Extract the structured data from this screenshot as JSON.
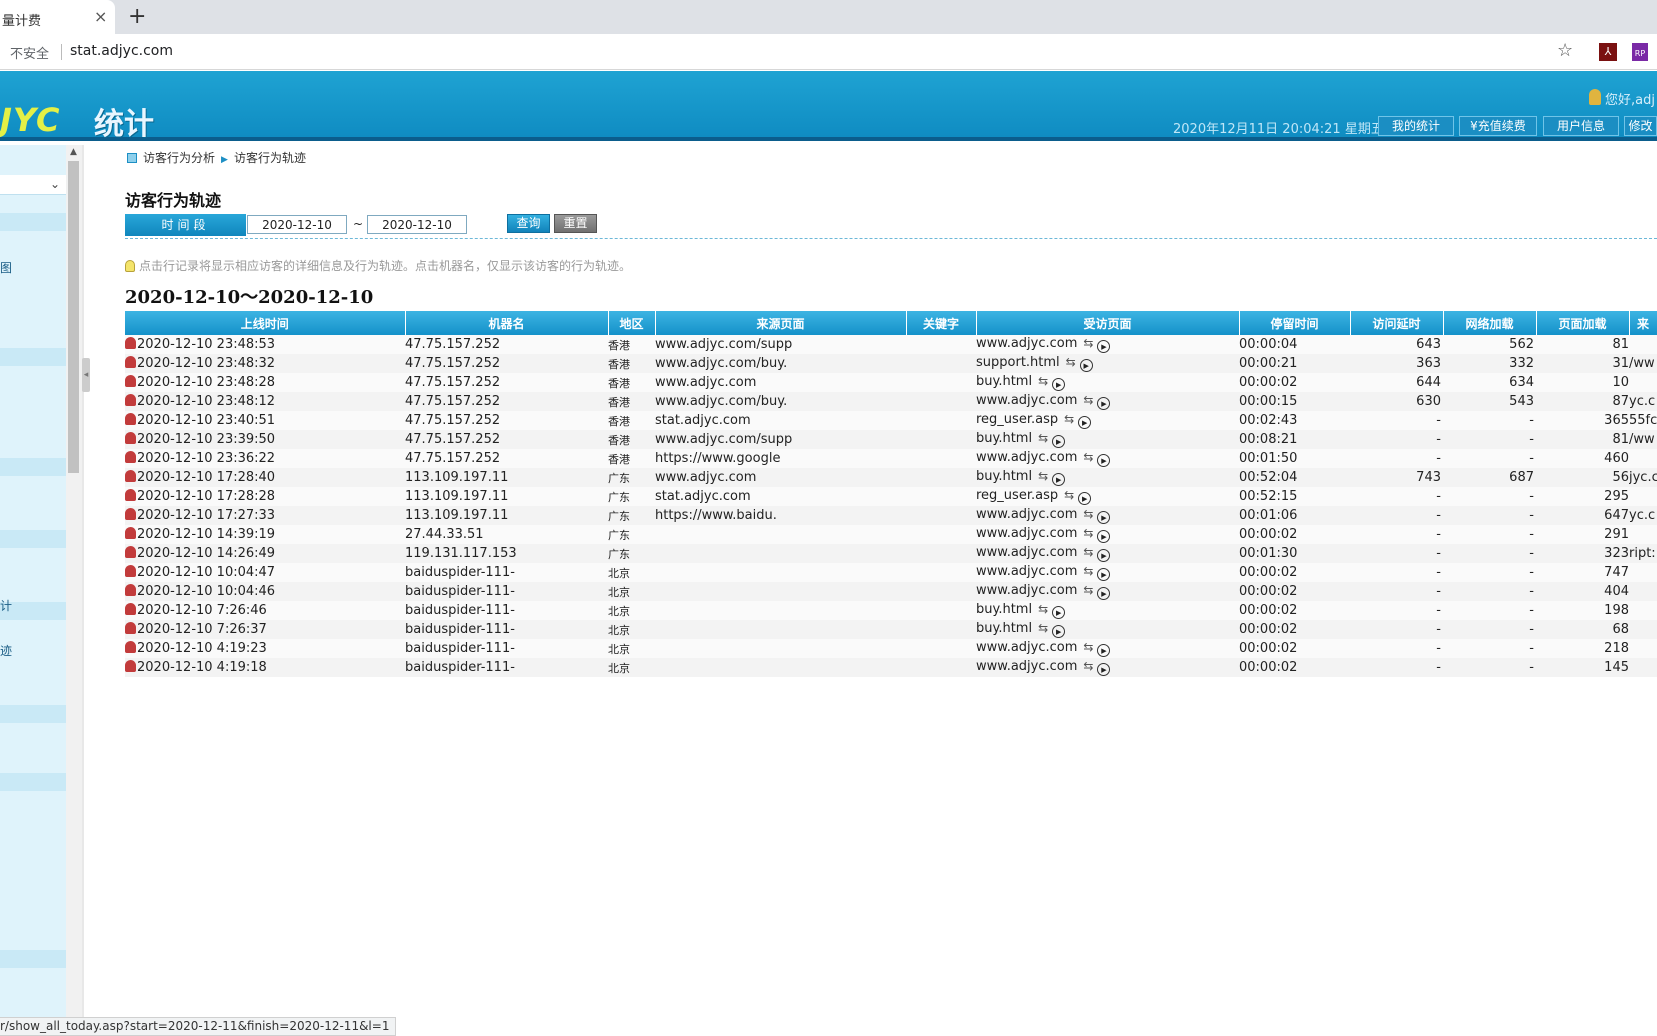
{
  "browser": {
    "tab_title": "量计费",
    "tab_close": "×",
    "new_tab": "+",
    "security_label": "不安全",
    "url": "stat.adjyc.com",
    "star": "☆",
    "status_url": "r/show_all_today.asp?start=2020-12-11&finish=2020-12-11&l=1"
  },
  "header": {
    "logo": "JYC",
    "logo_cn": "统计",
    "greeting": "您好,adj",
    "datetime": "2020年12月11日 20:04:21 星期五",
    "nav": [
      "我的统计",
      "¥充值续费",
      "用户信息",
      "修改"
    ]
  },
  "sidebar": {
    "fragments": [
      "图",
      "计",
      "迹"
    ]
  },
  "breadcrumb": {
    "parent": "访客行为分析",
    "current": "访客行为轨迹"
  },
  "page": {
    "title": "访客行为轨迹",
    "period_label": "时间段",
    "start_date": "2020-12-10",
    "tilde": "~",
    "end_date": "2020-12-10",
    "query_button": "查询",
    "reset_button": "重置",
    "hint": "点击行记录将显示相应访客的详细信息及行为轨迹。点击机器名，仅显示该访客的行为轨迹。",
    "range_title": "2020-12-10～2020-12-10"
  },
  "table": {
    "columns": [
      "上线时间",
      "机器名",
      "地区",
      "来源页面",
      "关键字",
      "受访页面",
      "停留时间",
      "访问延时",
      "网络加载",
      "页面加载",
      "来"
    ],
    "rows": [
      {
        "time": "2020-12-10 23:48:53",
        "host": "47.75.157.252",
        "region": "香港",
        "source": "www.adjyc.com/supp",
        "keyword": "",
        "page": "www.adjyc.com",
        "stay": "00:00:04",
        "delay": "643",
        "net": "562",
        "load": "81",
        "extra": ""
      },
      {
        "time": "2020-12-10 23:48:32",
        "host": "47.75.157.252",
        "region": "香港",
        "source": "www.adjyc.com/buy.",
        "keyword": "",
        "page": "support.html",
        "stay": "00:00:21",
        "delay": "363",
        "net": "332",
        "load": "31",
        "extra": "/ww"
      },
      {
        "time": "2020-12-10 23:48:28",
        "host": "47.75.157.252",
        "region": "香港",
        "source": "www.adjyc.com",
        "keyword": "",
        "page": "buy.html",
        "stay": "00:00:02",
        "delay": "644",
        "net": "634",
        "load": "10",
        "extra": ""
      },
      {
        "time": "2020-12-10 23:48:12",
        "host": "47.75.157.252",
        "region": "香港",
        "source": "www.adjyc.com/buy.",
        "keyword": "",
        "page": "www.adjyc.com",
        "stay": "00:00:15",
        "delay": "630",
        "net": "543",
        "load": "87",
        "extra": "yc.c"
      },
      {
        "time": "2020-12-10 23:40:51",
        "host": "47.75.157.252",
        "region": "香港",
        "source": "stat.adjyc.com",
        "keyword": "",
        "page": "reg_user.asp",
        "stay": "00:02:43",
        "delay": "-",
        "net": "-",
        "load": "365",
        "extra": "55fc"
      },
      {
        "time": "2020-12-10 23:39:50",
        "host": "47.75.157.252",
        "region": "香港",
        "source": "www.adjyc.com/supp",
        "keyword": "",
        "page": "buy.html",
        "stay": "00:08:21",
        "delay": "-",
        "net": "-",
        "load": "81",
        "extra": "/ww"
      },
      {
        "time": "2020-12-10 23:36:22",
        "host": "47.75.157.252",
        "region": "香港",
        "source": "https://www.google",
        "keyword": "",
        "page": "www.adjyc.com",
        "stay": "00:01:50",
        "delay": "-",
        "net": "-",
        "load": "460",
        "extra": ""
      },
      {
        "time": "2020-12-10 17:28:40",
        "host": "113.109.197.11",
        "region": "广东",
        "source": "www.adjyc.com",
        "keyword": "",
        "page": "buy.html",
        "stay": "00:52:04",
        "delay": "743",
        "net": "687",
        "load": "56",
        "extra": "jyc.c"
      },
      {
        "time": "2020-12-10 17:28:28",
        "host": "113.109.197.11",
        "region": "广东",
        "source": "stat.adjyc.com",
        "keyword": "",
        "page": "reg_user.asp",
        "stay": "00:52:15",
        "delay": "-",
        "net": "-",
        "load": "295",
        "extra": ""
      },
      {
        "time": "2020-12-10 17:27:33",
        "host": "113.109.197.11",
        "region": "广东",
        "source": "https://www.baidu.",
        "keyword": "",
        "page": "www.adjyc.com",
        "stay": "00:01:06",
        "delay": "-",
        "net": "-",
        "load": "647",
        "extra": "yc.c"
      },
      {
        "time": "2020-12-10 14:39:19",
        "host": "27.44.33.51",
        "region": "广东",
        "source": "",
        "keyword": "",
        "page": "www.adjyc.com",
        "stay": "00:00:02",
        "delay": "-",
        "net": "-",
        "load": "291",
        "extra": ""
      },
      {
        "time": "2020-12-10 14:26:49",
        "host": "119.131.117.153",
        "region": "广东",
        "source": "",
        "keyword": "",
        "page": "www.adjyc.com",
        "stay": "00:01:30",
        "delay": "-",
        "net": "-",
        "load": "323",
        "extra": "ript:"
      },
      {
        "time": "2020-12-10 10:04:47",
        "host": "baiduspider-111-",
        "region": "北京",
        "source": "",
        "keyword": "",
        "page": "www.adjyc.com",
        "stay": "00:00:02",
        "delay": "-",
        "net": "-",
        "load": "747",
        "extra": ""
      },
      {
        "time": "2020-12-10 10:04:46",
        "host": "baiduspider-111-",
        "region": "北京",
        "source": "",
        "keyword": "",
        "page": "www.adjyc.com",
        "stay": "00:00:02",
        "delay": "-",
        "net": "-",
        "load": "404",
        "extra": ""
      },
      {
        "time": "2020-12-10 7:26:46",
        "host": "baiduspider-111-",
        "region": "北京",
        "source": "",
        "keyword": "",
        "page": "buy.html",
        "stay": "00:00:02",
        "delay": "-",
        "net": "-",
        "load": "198",
        "extra": ""
      },
      {
        "time": "2020-12-10 7:26:37",
        "host": "baiduspider-111-",
        "region": "北京",
        "source": "",
        "keyword": "",
        "page": "buy.html",
        "stay": "00:00:02",
        "delay": "-",
        "net": "-",
        "load": "68",
        "extra": ""
      },
      {
        "time": "2020-12-10 4:19:23",
        "host": "baiduspider-111-",
        "region": "北京",
        "source": "",
        "keyword": "",
        "page": "www.adjyc.com",
        "stay": "00:00:02",
        "delay": "-",
        "net": "-",
        "load": "218",
        "extra": ""
      },
      {
        "time": "2020-12-10 4:19:18",
        "host": "baiduspider-111-",
        "region": "北京",
        "source": "",
        "keyword": "",
        "page": "www.adjyc.com",
        "stay": "00:00:02",
        "delay": "-",
        "net": "-",
        "load": "145",
        "extra": ""
      }
    ]
  }
}
